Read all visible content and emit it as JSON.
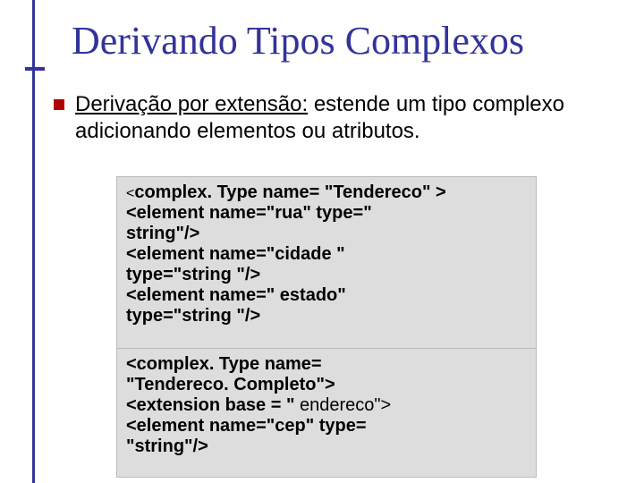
{
  "title": "Derivando Tipos Complexos",
  "bullet": {
    "lead": "Derivação por extensão:",
    "rest": "  estende um tipo complexo adicionando elementos ou atributos."
  },
  "code1": {
    "l1a": "<",
    "l1b": "complex. Type name= \"Tendereco\" >",
    "l2": "     <element name=\"rua\" type=\"",
    "l3": "string\"/>",
    "l4": "     <element name=\"cidade \"",
    "l5": "type=\"string \"/>",
    "l6": "     <element name=\" estado\"",
    "l7": "type=\"string \"/>"
  },
  "code2": {
    "l1": "<complex. Type name=",
    "l2": "\"Tendereco. Completo\">",
    "l3a": "   <extension base = \"",
    "l3b": " endereco\">",
    "l4": "       <element name=\"cep\" type=",
    "l5": "\"string\"/>"
  }
}
